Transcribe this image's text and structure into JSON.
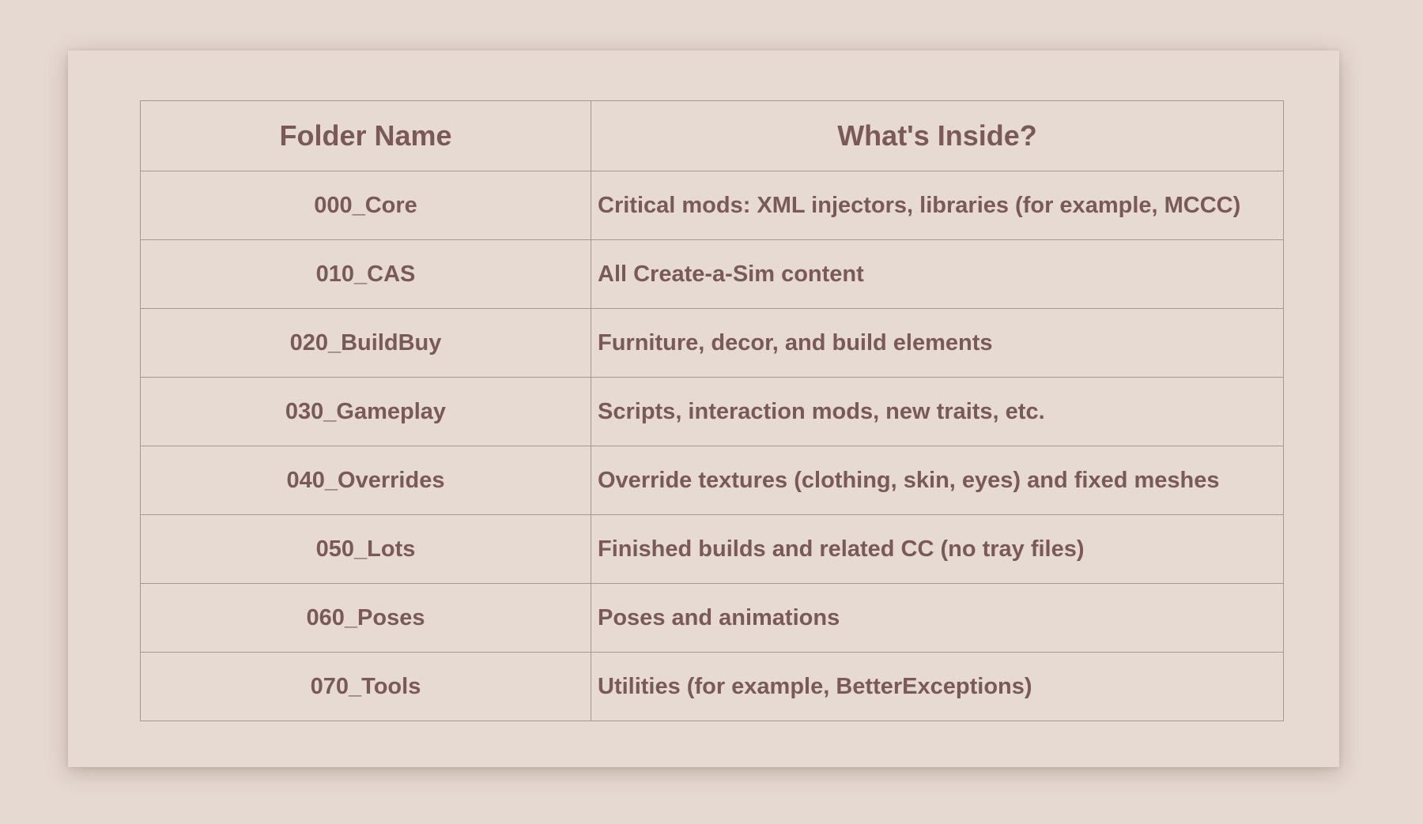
{
  "table": {
    "headers": [
      "Folder Name",
      "What's Inside?"
    ],
    "rows": [
      {
        "folder": "000_Core",
        "contents": "Critical mods: XML injectors, libraries (for example, MCCC)"
      },
      {
        "folder": "010_CAS",
        "contents": "All Create-a-Sim content"
      },
      {
        "folder": "020_BuildBuy",
        "contents": "Furniture, decor, and build elements"
      },
      {
        "folder": "030_Gameplay",
        "contents": "Scripts, interaction mods, new traits, etc."
      },
      {
        "folder": "040_Overrides",
        "contents": "Override textures (clothing, skin, eyes) and fixed meshes"
      },
      {
        "folder": "050_Lots",
        "contents": "Finished builds and related CC (no tray files)"
      },
      {
        "folder": "060_Poses",
        "contents": "Poses and animations"
      },
      {
        "folder": "070_Tools",
        "contents": "Utilities (for example, BetterExceptions)"
      }
    ]
  },
  "colors": {
    "background": "#e6d9d1",
    "text": "#7a5a58",
    "border": "#a99591"
  }
}
